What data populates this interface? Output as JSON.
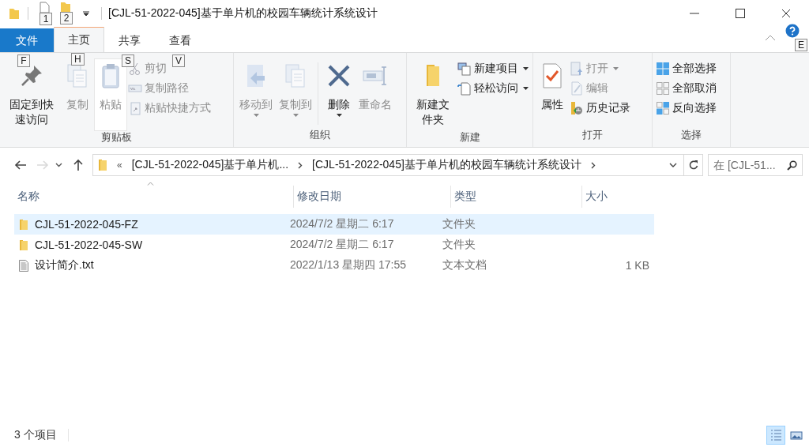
{
  "window": {
    "title": "[CJL-51-2022-045]基于单片机的校园车辆统计系统设计"
  },
  "quick_access": {
    "keytips": [
      "1",
      "2"
    ]
  },
  "tabs": [
    {
      "label": "文件",
      "kind": "file",
      "keytip": "F",
      "selected": false
    },
    {
      "label": "主页",
      "kind": "tab",
      "keytip": "H",
      "selected": true
    },
    {
      "label": "共享",
      "kind": "tab",
      "keytip": "S",
      "selected": false
    },
    {
      "label": "查看",
      "kind": "tab",
      "keytip": "V",
      "selected": false
    }
  ],
  "help": {
    "keytip": "E"
  },
  "ribbon": {
    "groups": [
      {
        "label": "剪贴板",
        "items": [
          {
            "kind": "large",
            "label": "固定到快速访问",
            "disabled": false,
            "dropdown": false,
            "highlighted": false
          },
          {
            "kind": "large",
            "label": "复制",
            "disabled": true,
            "dropdown": false,
            "highlighted": false
          },
          {
            "kind": "large",
            "label": "粘贴",
            "disabled": true,
            "dropdown": false,
            "highlighted": true
          },
          {
            "kind": "stack",
            "items": [
              {
                "label": "剪切",
                "disabled": true,
                "dropdown": false
              },
              {
                "label": "复制路径",
                "disabled": true,
                "dropdown": false
              },
              {
                "label": "粘贴快捷方式",
                "disabled": true,
                "dropdown": false
              }
            ]
          }
        ]
      },
      {
        "label": "组织",
        "items": [
          {
            "kind": "large",
            "label": "移动到",
            "disabled": true,
            "dropdown": true,
            "highlighted": false
          },
          {
            "kind": "large",
            "label": "复制到",
            "disabled": true,
            "dropdown": true,
            "highlighted": false
          },
          {
            "kind": "separator"
          },
          {
            "kind": "large",
            "label": "删除",
            "disabled": false,
            "dropdown": true,
            "highlighted": false
          },
          {
            "kind": "large",
            "label": "重命名",
            "disabled": true,
            "dropdown": false,
            "highlighted": false
          }
        ]
      },
      {
        "label": "新建",
        "items": [
          {
            "kind": "large",
            "label": "新建文件夹",
            "disabled": false,
            "dropdown": false,
            "highlighted": false
          },
          {
            "kind": "stack",
            "items": [
              {
                "label": "新建项目",
                "disabled": false,
                "dropdown": true
              },
              {
                "label": "轻松访问",
                "disabled": false,
                "dropdown": true
              }
            ]
          }
        ]
      },
      {
        "label": "打开",
        "items": [
          {
            "kind": "large",
            "label": "属性",
            "disabled": false,
            "dropdown": false,
            "highlighted": false
          },
          {
            "kind": "stack",
            "items": [
              {
                "label": "打开",
                "disabled": true,
                "dropdown": true
              },
              {
                "label": "编辑",
                "disabled": true,
                "dropdown": false
              },
              {
                "label": "历史记录",
                "disabled": false,
                "dropdown": false
              }
            ]
          }
        ]
      },
      {
        "label": "选择",
        "items": [
          {
            "kind": "stack",
            "items": [
              {
                "label": "全部选择",
                "disabled": false,
                "dropdown": false
              },
              {
                "label": "全部取消",
                "disabled": false,
                "dropdown": false
              },
              {
                "label": "反向选择",
                "disabled": false,
                "dropdown": false
              }
            ]
          }
        ]
      }
    ]
  },
  "navigation": {
    "back_disabled": false,
    "forward_disabled": true
  },
  "address": {
    "overflow": "«",
    "segments": [
      "[CJL-51-2022-045]基于单片机...",
      "[CJL-51-2022-045]基于单片机的校园车辆统计系统设计"
    ]
  },
  "search": {
    "placeholder": "在 [CJL-51..."
  },
  "table": {
    "columns": [
      "名称",
      "修改日期",
      "类型",
      "大小"
    ],
    "rows": [
      {
        "kind": "folder",
        "name": "CJL-51-2022-045-FZ",
        "modified": "2024/7/2 星期二 6:17",
        "type": "文件夹",
        "size": "",
        "selected": true
      },
      {
        "kind": "folder",
        "name": "CJL-51-2022-045-SW",
        "modified": "2024/7/2 星期二 6:17",
        "type": "文件夹",
        "size": "",
        "selected": false
      },
      {
        "kind": "text",
        "name": "设计简介.txt",
        "modified": "2022/1/13 星期四 17:55",
        "type": "文本文档",
        "size": "1 KB",
        "selected": false
      }
    ]
  },
  "status_bar": {
    "count": "3 个项目",
    "views": [
      {
        "kind": "details",
        "selected": true
      },
      {
        "kind": "large-icons",
        "selected": false
      }
    ]
  }
}
